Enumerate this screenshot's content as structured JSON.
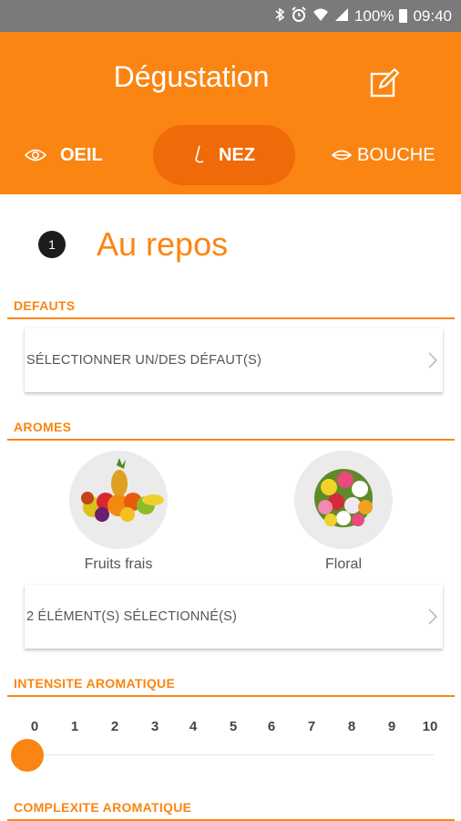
{
  "status_bar": {
    "battery": "100%",
    "time": "09:40"
  },
  "header": {
    "title": "Dégustation",
    "edit_icon": "edit-icon"
  },
  "tabs": [
    {
      "label": "OEIL",
      "icon": "eye-icon",
      "active": false
    },
    {
      "label": "NEZ",
      "icon": "nose-icon",
      "active": true
    },
    {
      "label": "BOUCHE",
      "icon": "mouth-icon",
      "active": false
    }
  ],
  "section": {
    "step": "1",
    "title": "Au repos"
  },
  "defauts": {
    "label": "DEFAUTS",
    "selector_text": "SÉLECTIONNER UN/DES DÉFAUT(S)"
  },
  "aromes": {
    "label": "AROMES",
    "items": [
      {
        "label": "Fruits frais"
      },
      {
        "label": "Floral"
      }
    ],
    "selector_text": "2 ÉLÉMENT(S) SÉLECTIONNÉ(S)"
  },
  "intensite": {
    "label": "INTENSITE AROMATIQUE",
    "ticks": [
      "0",
      "1",
      "2",
      "3",
      "4",
      "5",
      "6",
      "7",
      "8",
      "9",
      "10"
    ],
    "value": 0
  },
  "complexite": {
    "label": "COMPLEXITE AROMATIQUE"
  },
  "colors": {
    "accent": "#fb8512",
    "accent_dark": "#f06a0a",
    "status_bar": "#7a7a7a"
  }
}
